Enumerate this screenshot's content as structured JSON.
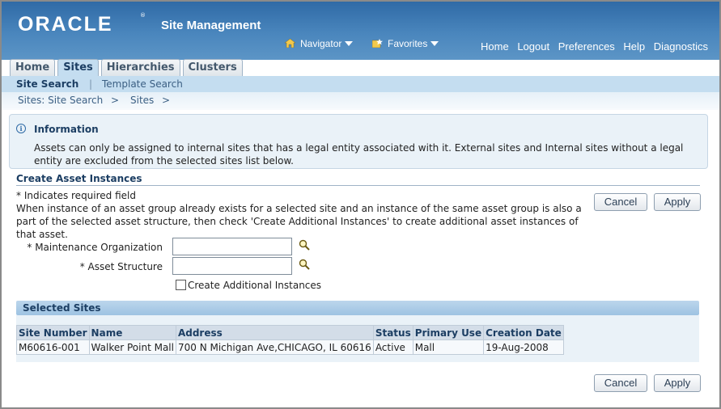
{
  "header": {
    "logo": "ORACLE",
    "logo_mark": "®",
    "app_title": "Site Management",
    "navigator_label": "Navigator",
    "favorites_label": "Favorites",
    "global_links": [
      "Home",
      "Logout",
      "Preferences",
      "Help",
      "Diagnostics"
    ]
  },
  "tabs": [
    {
      "label": "Home",
      "active": false
    },
    {
      "label": "Sites",
      "active": true
    },
    {
      "label": "Hierarchies",
      "active": false
    },
    {
      "label": "Clusters",
      "active": false
    }
  ],
  "subtabs": {
    "site_search": "Site Search",
    "separator": "|",
    "template_search": "Template Search"
  },
  "breadcrumb": {
    "items": [
      "Sites: Site Search",
      "Sites"
    ],
    "separator": ">"
  },
  "info": {
    "title": "Information",
    "message": "Assets can only be assigned to internal sites that has a legal entity associated with it. External sites and Internal sites without a legal entity are excluded from the selected sites list below."
  },
  "section": {
    "title": "Create Asset Instances",
    "required_note": "* Indicates required field",
    "instructions": "When instance of an asset group already exists for a selected site and an instance of the same asset group is also a part of the selected asset structure, then check 'Create Additional Instances' to create additional asset instances of that asset."
  },
  "buttons": {
    "cancel": "Cancel",
    "apply": "Apply"
  },
  "form": {
    "maintenance_org_label": "* Maintenance Organization",
    "maintenance_org_value": "",
    "asset_structure_label": "* Asset Structure",
    "asset_structure_value": "",
    "create_additional_label": "Create Additional Instances",
    "create_additional_checked": false
  },
  "selected_sites": {
    "title": "Selected Sites",
    "columns": [
      "Site Number",
      "Name",
      "Address",
      "Status",
      "Primary Use",
      "Creation Date"
    ],
    "rows": [
      [
        "M60616-001",
        "Walker Point Mall",
        "700 N Michigan Ave,CHICAGO, IL 60616",
        "Active",
        "Mall",
        "19-Aug-2008"
      ]
    ]
  },
  "colors": {
    "header_blue": "#2f6aa6",
    "subtab_blue": "#c4ddf0",
    "info_bg": "#eaf2f8",
    "title_text": "#1c3e63"
  }
}
